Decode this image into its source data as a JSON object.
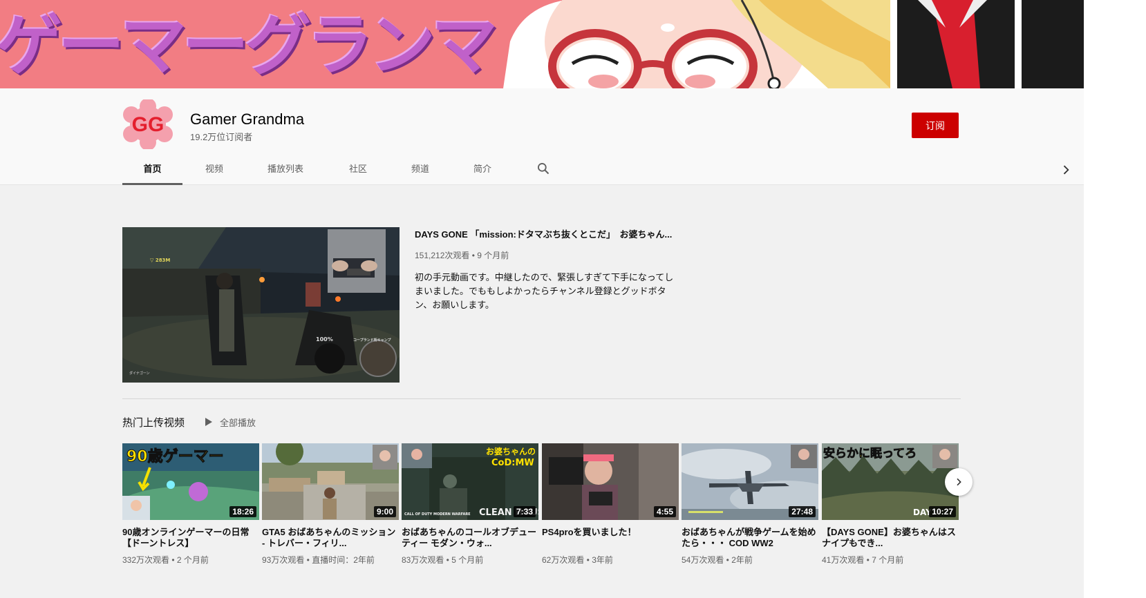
{
  "banner": {
    "title": "ゲーマーグランマ"
  },
  "channel": {
    "avatar_text": "GG",
    "name": "Gamer Grandma",
    "subscribers": "19.2万位订阅者",
    "subscribe_label": "订阅",
    "colors": {
      "brand_red": "#cc0000",
      "avatar_pink": "#f4a0ad"
    }
  },
  "tabs": [
    {
      "label": "首页",
      "active": true
    },
    {
      "label": "视频"
    },
    {
      "label": "播放列表"
    },
    {
      "label": "社区"
    },
    {
      "label": "频道"
    },
    {
      "label": "简介"
    }
  ],
  "icons": {
    "search": "search-icon",
    "tabs_next": "chevron-right-icon",
    "play_all": "play-icon",
    "shelf_next": "chevron-right-icon"
  },
  "featured": {
    "title": "DAYS GONE 「mission:ドタマぶち抜くとこだ」　お婆ちゃん...",
    "meta": "151,212次观看 • 9 个月前",
    "description": "初の手元動画です。中継したので、緊張しすぎて下手になってしまいました。でももしよかったらチャンネル登録とグッドボタン、お願いします。",
    "thumb_text": {
      "hud_top": "▽ 283M",
      "percent": "100%",
      "label1": "コープランド所キャンプ",
      "label2": "ダイナゴーン"
    }
  },
  "shelf": {
    "title": "热门上传视频",
    "play_all": "全部播放",
    "videos": [
      {
        "title": "90歳オンラインゲーマーの日常【ドーントレス】",
        "meta": "332万次观看 • 2 个月前",
        "duration": "18:26",
        "thumb_text": "90歳ゲーマー"
      },
      {
        "title": "GTA5 おばあちゃんのミッション - トレバー・フィリ...",
        "meta": "93万次观看 • 直播时间：2年前",
        "duration": "9:00"
      },
      {
        "title": "おばあちゃんのコールオブデューティー モダン・ウォ...",
        "meta": "83万次观看 • 5 个月前",
        "duration": "7:33",
        "thumb_text": "お婆ちゃんの",
        "thumb_text2": "CoD:MW",
        "thumb_text3": "CLEAN HOUSE",
        "thumb_text4": "CALL OF DUTY MODERN WARFARE"
      },
      {
        "title": "PS4proを買いました！",
        "meta": "62万次观看 • 3年前",
        "duration": "4:55"
      },
      {
        "title": "おばあちゃんが戦争ゲームを始めたら・・・ COD WW2",
        "meta": "54万次观看 • 2年前",
        "duration": "27:48"
      },
      {
        "title": "【DAYS GONE】お婆ちゃんはスナイプもでき...",
        "meta": "41万次观看 • 7 个月前",
        "duration": "10:27",
        "thumb_text": "安らかに眠ってろ",
        "thumb_text2": "DAY"
      }
    ]
  }
}
